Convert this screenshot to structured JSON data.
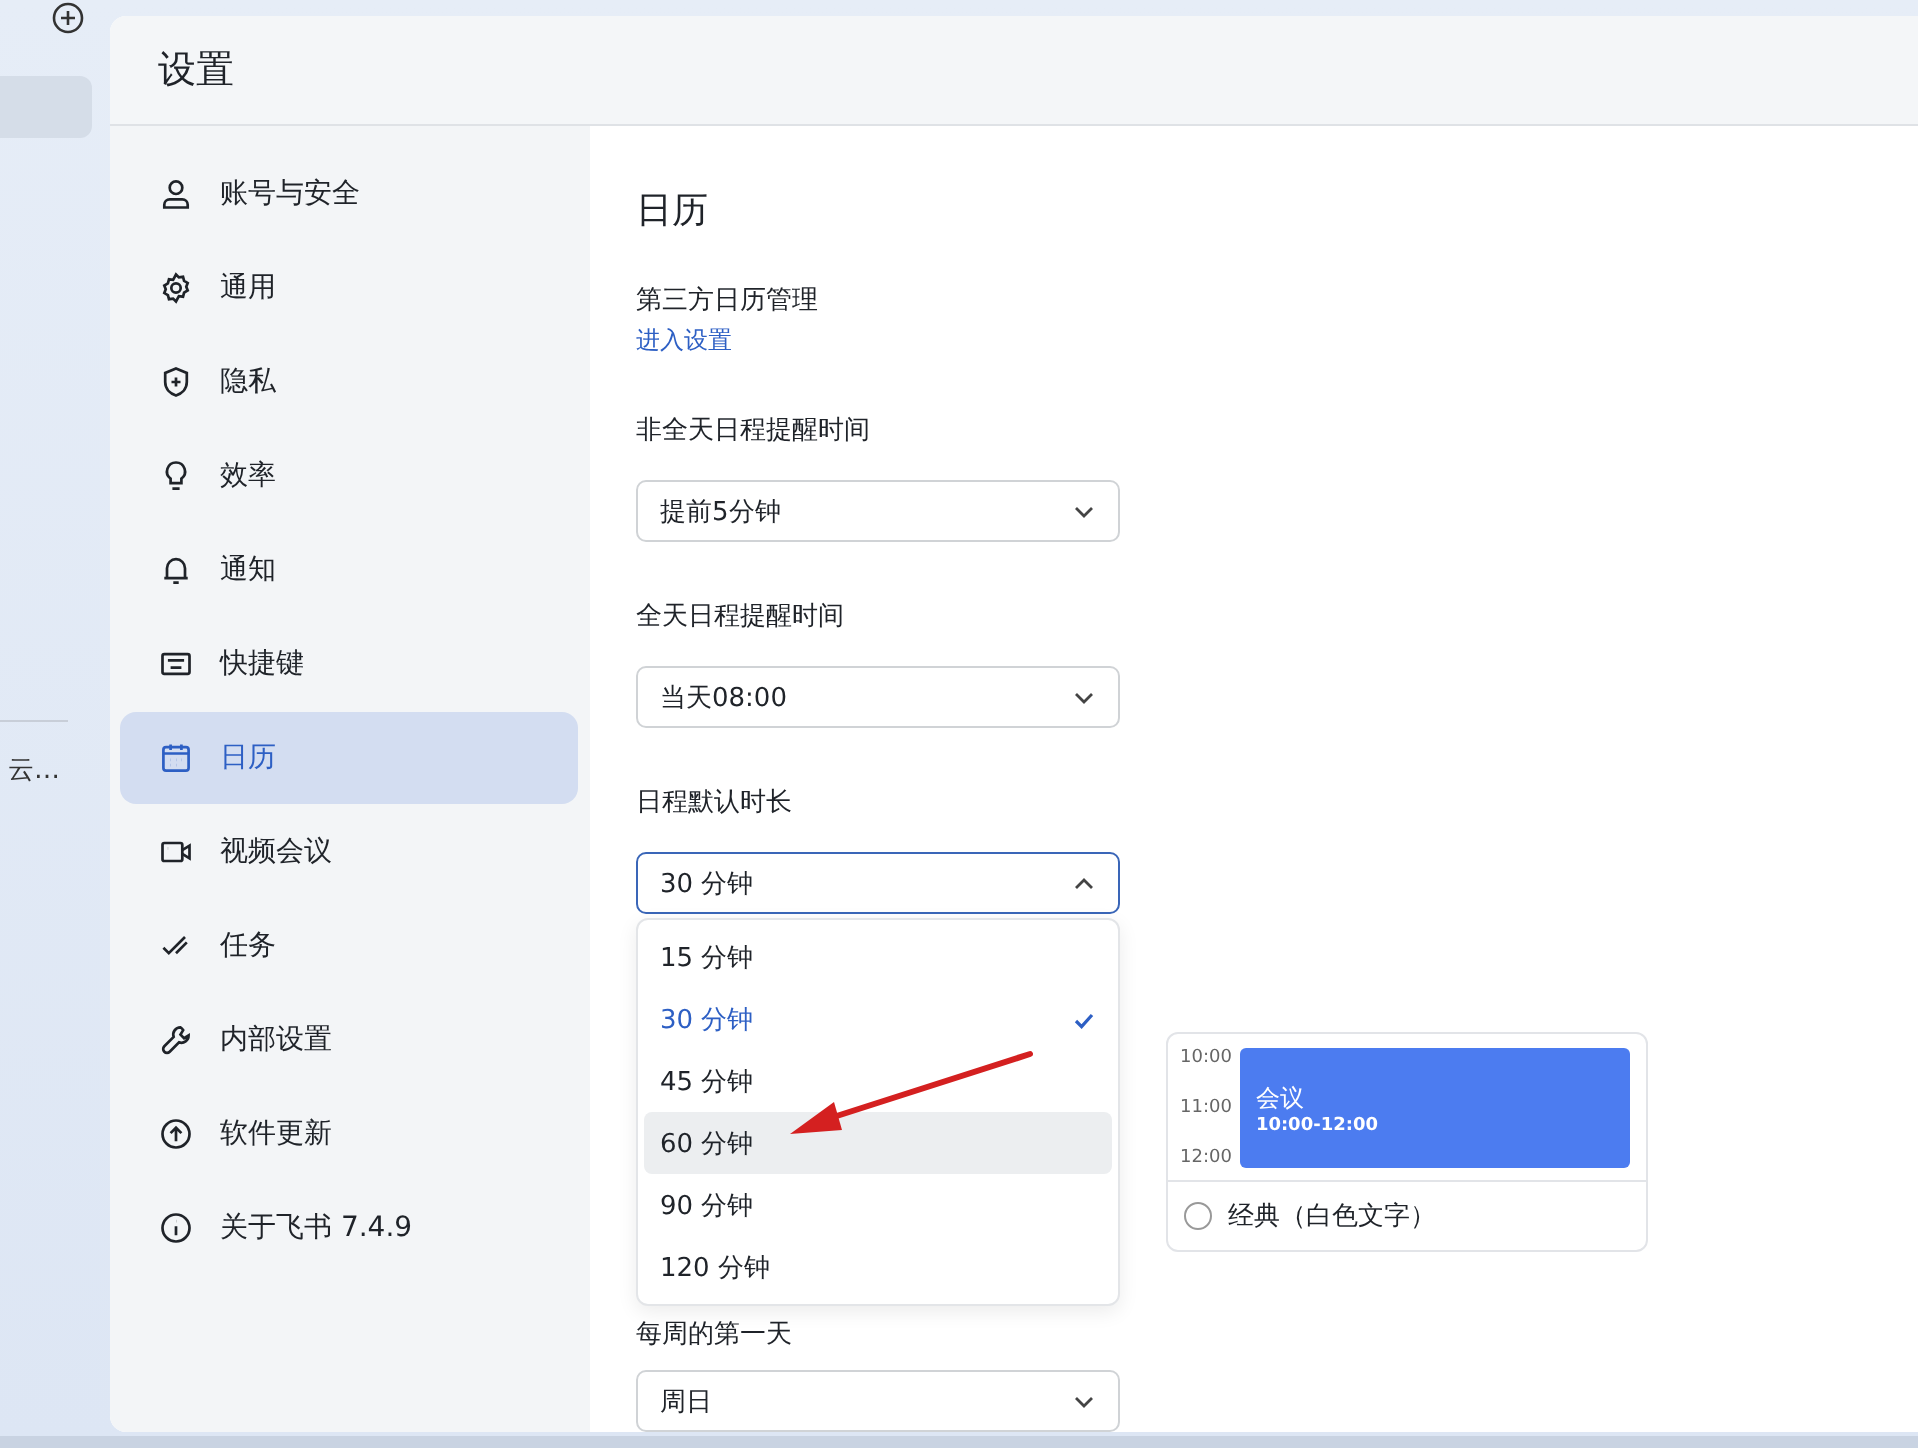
{
  "background_app": {
    "item_label": "云…"
  },
  "window": {
    "title": "设置"
  },
  "sidebar": {
    "items": [
      {
        "label": "账号与安全",
        "selected": false
      },
      {
        "label": "通用",
        "selected": false
      },
      {
        "label": "隐私",
        "selected": false
      },
      {
        "label": "效率",
        "selected": false
      },
      {
        "label": "通知",
        "selected": false
      },
      {
        "label": "快捷键",
        "selected": false
      },
      {
        "label": "日历",
        "selected": true
      },
      {
        "label": "视频会议",
        "selected": false
      },
      {
        "label": "任务",
        "selected": false
      },
      {
        "label": "内部设置",
        "selected": false
      },
      {
        "label": "软件更新",
        "selected": false
      },
      {
        "label": "关于飞书 7.4.9",
        "selected": false
      }
    ]
  },
  "content": {
    "title": "日历",
    "third_party": {
      "label": "第三方日历管理",
      "link": "进入设置"
    },
    "settings": [
      {
        "label": "非全天日程提醒时间",
        "value": "提前5分钟",
        "open": false
      },
      {
        "label": "全天日程提醒时间",
        "value": "当天08:00",
        "open": false
      },
      {
        "label": "日程默认时长",
        "value": "30 分钟",
        "open": true
      }
    ],
    "dropdown": {
      "options": [
        {
          "label": "15 分钟",
          "selected": false,
          "highlighted": false
        },
        {
          "label": "30 分钟",
          "selected": true,
          "highlighted": false
        },
        {
          "label": "45 分钟",
          "selected": false,
          "highlighted": false
        },
        {
          "label": "60 分钟",
          "selected": false,
          "highlighted": true
        },
        {
          "label": "90 分钟",
          "selected": false,
          "highlighted": false
        },
        {
          "label": "120 分钟",
          "selected": false,
          "highlighted": false
        }
      ]
    },
    "preview": {
      "times": [
        "10:00",
        "11:00",
        "12:00"
      ],
      "event_title": "会议",
      "event_time": "10:00-12:00",
      "option": {
        "label": "经典（白色文字）",
        "selected": false
      }
    },
    "week_start": {
      "label": "每周的第一天",
      "value": "周日",
      "open": false
    }
  }
}
